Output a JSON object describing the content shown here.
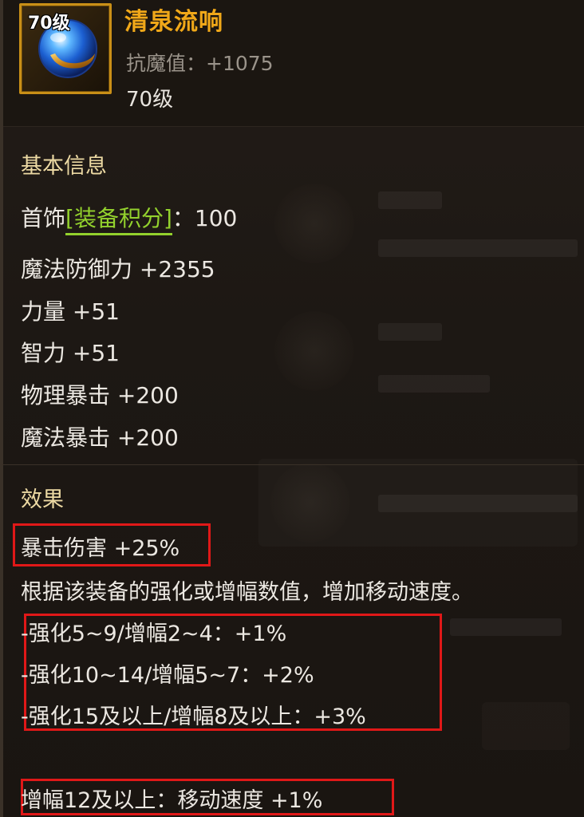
{
  "item": {
    "level_badge": "70级",
    "name": "清泉流响",
    "stat": "抗魔值：+1075",
    "level": "70级"
  },
  "basic": {
    "title": "基本信息",
    "slot": "首饰",
    "points_label": "[装备积分]",
    "points_value": "：100",
    "stats": [
      "魔法防御力 +2355",
      "力量 +51",
      "智力 +51",
      "物理暴击 +200",
      "魔法暴击 +200"
    ]
  },
  "effects": {
    "title": "效果",
    "crit_damage": "暴击伤害 +25%",
    "description": "根据该装备的强化或增幅数值，增加移动速度。",
    "tiers": [
      "-强化5~9/增幅2~4：+1%",
      "-强化10~14/增幅5~7：+2%",
      "-强化15及以上/增幅8及以上：+3%"
    ],
    "bonus": "增幅12及以上：移动速度 +1%"
  },
  "colors": {
    "name": "#f0a819",
    "section_title": "#ecd9a3",
    "points": "#93d12d",
    "highlight": "#e01818",
    "frame": "#c98f17"
  }
}
